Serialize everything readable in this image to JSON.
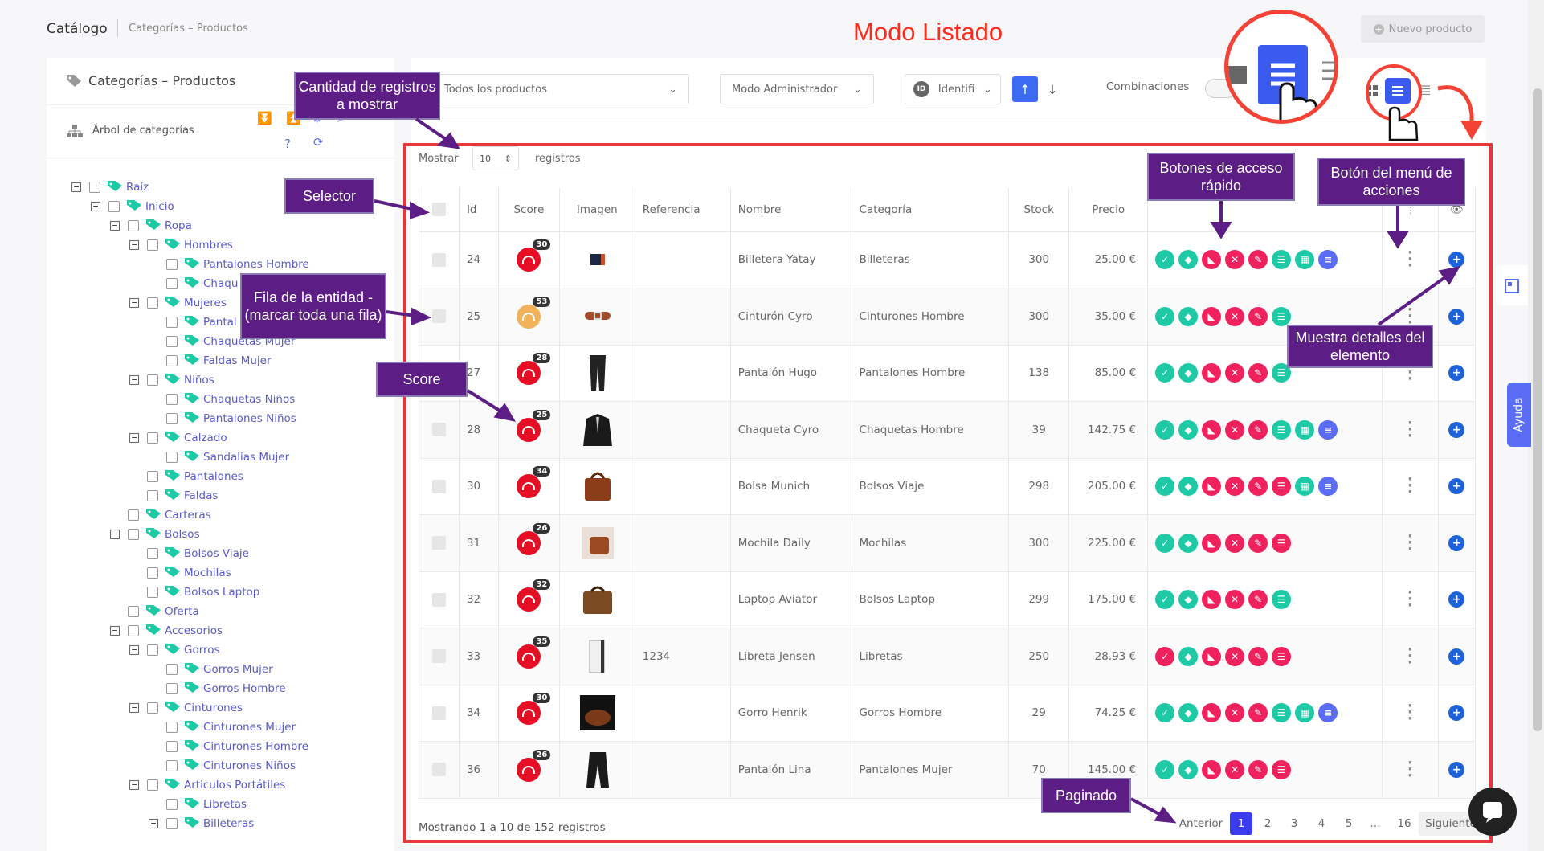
{
  "breadcrumb": {
    "title": "Catálogo",
    "sub": "Categorías – Productos"
  },
  "new_product_label": "Nuevo producto",
  "annotation_title": "Modo Listado",
  "sidebar": {
    "title": "Categorías – Productos",
    "tree_label": "Árbol de categorías",
    "nodes": [
      "Raíz",
      "Inicio",
      "Ropa",
      "Hombres",
      "Pantalones Hombre",
      "Chaqu",
      "Mujeres",
      "Pantal",
      "Chaquetas Mujer",
      "Faldas Mujer",
      "Niños",
      "Chaquetas Niños",
      "Pantalones Niños",
      "Calzado",
      "Sandalias Mujer",
      "Pantalones",
      "Faldas",
      "Carteras",
      "Bolsos",
      "Bolsos Viaje",
      "Mochilas",
      "Bolsos Laptop",
      "Oferta",
      "Accesorios",
      "Gorros",
      "Gorros Mujer",
      "Gorros Hombre",
      "Cinturones",
      "Cinturones Mujer",
      "Cinturones Hombre",
      "Cinturones Niños",
      "Articulos Portátiles",
      "Libretas",
      "Billeteras"
    ]
  },
  "filters": {
    "products": "Todos los productos",
    "mode": "Modo Administrador",
    "sort_field": "Identifi",
    "combinations": "Combinaciones"
  },
  "table_controls": {
    "show": "Mostrar",
    "count": "10",
    "records": "registros"
  },
  "columns": [
    "Id",
    "Score",
    "Imagen",
    "Referencia",
    "Nombre",
    "Categoría",
    "Stock",
    "Precio"
  ],
  "rows": [
    {
      "id": "24",
      "score": "30",
      "score_color": "#e60e25",
      "ref": "",
      "name": "Billetera Yatay",
      "category": "Billeteras",
      "stock": "300",
      "price": "25.00 €",
      "qa": [
        "#1ec9a6",
        "#1ec9a6",
        "#f0225e",
        "#f0225e",
        "#f0225e",
        "#1ec9a6",
        "#1ec9a6",
        "#5b6cf5"
      ]
    },
    {
      "id": "25",
      "score": "53",
      "score_color": "#f0b25a",
      "ref": "",
      "name": "Cinturón Cyro",
      "category": "Cinturones Hombre",
      "stock": "300",
      "price": "35.00 €",
      "qa": [
        "#1ec9a6",
        "#1ec9a6",
        "#f0225e",
        "#f0225e",
        "#f0225e",
        "#1ec9a6"
      ]
    },
    {
      "id": "27",
      "score": "28",
      "score_color": "#e60e25",
      "ref": "",
      "name": "Pantalón Hugo",
      "category": "Pantalones Hombre",
      "stock": "138",
      "price": "85.00 €",
      "qa": [
        "#1ec9a6",
        "#1ec9a6",
        "#f0225e",
        "#f0225e",
        "#f0225e",
        "#1ec9a6"
      ]
    },
    {
      "id": "28",
      "score": "25",
      "score_color": "#e60e25",
      "ref": "",
      "name": "Chaqueta Cyro",
      "category": "Chaquetas Hombre",
      "stock": "39",
      "price": "142.75 €",
      "qa": [
        "#1ec9a6",
        "#1ec9a6",
        "#f0225e",
        "#f0225e",
        "#f0225e",
        "#1ec9a6",
        "#1ec9a6",
        "#5b6cf5"
      ]
    },
    {
      "id": "30",
      "score": "34",
      "score_color": "#e60e25",
      "ref": "",
      "name": "Bolsa Munich",
      "category": "Bolsos Viaje",
      "stock": "298",
      "price": "205.00 €",
      "qa": [
        "#1ec9a6",
        "#1ec9a6",
        "#f0225e",
        "#f0225e",
        "#f0225e",
        "#f0225e",
        "#1ec9a6",
        "#5b6cf5"
      ]
    },
    {
      "id": "31",
      "score": "26",
      "score_color": "#e60e25",
      "ref": "",
      "name": "Mochila Daily",
      "category": "Mochilas",
      "stock": "300",
      "price": "225.00 €",
      "qa": [
        "#1ec9a6",
        "#1ec9a6",
        "#f0225e",
        "#f0225e",
        "#f0225e",
        "#f0225e"
      ]
    },
    {
      "id": "32",
      "score": "32",
      "score_color": "#e60e25",
      "ref": "",
      "name": "Laptop Aviator",
      "category": "Bolsos Laptop",
      "stock": "299",
      "price": "175.00 €",
      "qa": [
        "#1ec9a6",
        "#1ec9a6",
        "#f0225e",
        "#f0225e",
        "#f0225e",
        "#1ec9a6"
      ]
    },
    {
      "id": "33",
      "score": "35",
      "score_color": "#e60e25",
      "ref": "1234",
      "name": "Libreta Jensen",
      "category": "Libretas",
      "stock": "250",
      "price": "28.93 €",
      "qa": [
        "#f0225e",
        "#1ec9a6",
        "#f0225e",
        "#f0225e",
        "#f0225e",
        "#f0225e"
      ]
    },
    {
      "id": "34",
      "score": "30",
      "score_color": "#e60e25",
      "ref": "",
      "name": "Gorro Henrik",
      "category": "Gorros Hombre",
      "stock": "29",
      "price": "74.25 €",
      "qa": [
        "#1ec9a6",
        "#1ec9a6",
        "#f0225e",
        "#f0225e",
        "#f0225e",
        "#1ec9a6",
        "#1ec9a6",
        "#5b6cf5"
      ]
    },
    {
      "id": "36",
      "score": "26",
      "score_color": "#e60e25",
      "ref": "",
      "name": "Pantalón Lina",
      "category": "Pantalones Mujer",
      "stock": "70",
      "price": "145.00 €",
      "qa": [
        "#1ec9a6",
        "#1ec9a6",
        "#f0225e",
        "#f0225e",
        "#f0225e",
        "#f0225e"
      ]
    }
  ],
  "footer": {
    "info": "Mostrando 1 a 10 de 152 registros",
    "prev": "Anterior",
    "next": "Siguiente",
    "pages": [
      "1",
      "2",
      "3",
      "4",
      "5",
      "…",
      "16"
    ]
  },
  "callouts": {
    "cantidad": "Cantidad de registros a mostrar",
    "selector": "Selector",
    "fila": "Fila de la entidad - (marcar toda una fila)",
    "score": "Score",
    "botones": "Botones de acceso rápido",
    "menu": "Botón del menú de acciones",
    "detalles": "Muestra detalles del elemento",
    "paginado": "Paginado"
  },
  "help_label": "Ayuda"
}
